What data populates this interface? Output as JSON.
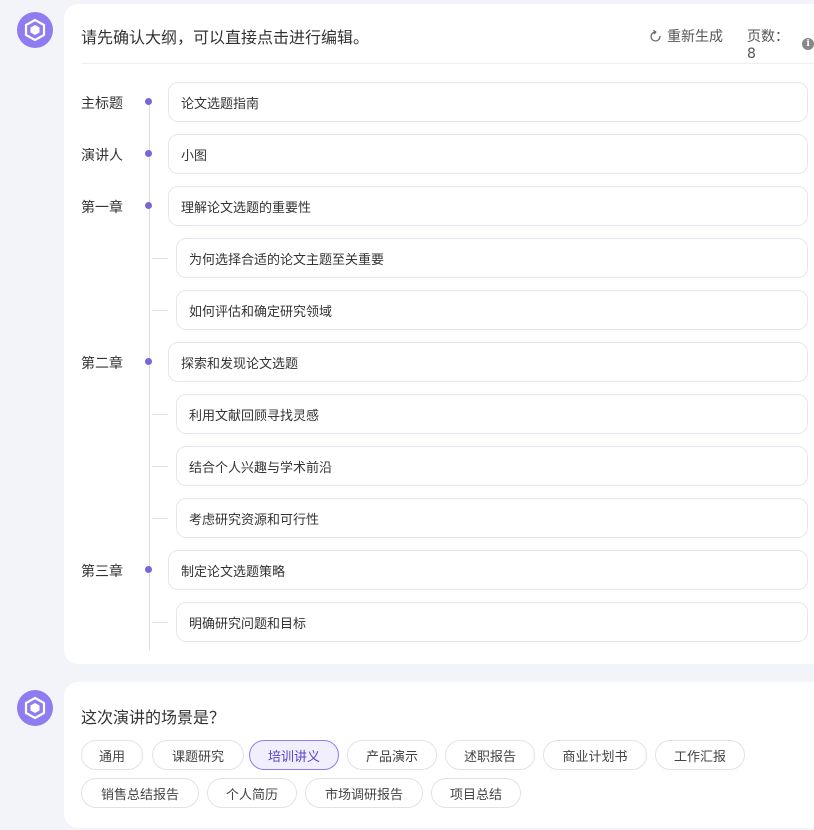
{
  "outline": {
    "prompt": "请先确认大纲，可以直接点击进行编辑。",
    "regenerate_label": "重新生成",
    "pages_label": "页数：8",
    "info_glyph": "i",
    "rows": [
      {
        "label": "主标题",
        "text": "论文选题指南"
      },
      {
        "label": "演讲人",
        "text": "小图"
      },
      {
        "label": "第一章",
        "text": "理解论文选题的重要性"
      },
      {
        "label": "",
        "text": "为何选择合适的论文主题至关重要"
      },
      {
        "label": "",
        "text": "如何评估和确定研究领域"
      },
      {
        "label": "第二章",
        "text": "探索和发现论文选题"
      },
      {
        "label": "",
        "text": "利用文献回顾寻找灵感"
      },
      {
        "label": "",
        "text": "结合个人兴趣与学术前沿"
      },
      {
        "label": "",
        "text": "考虑研究资源和可行性"
      },
      {
        "label": "第三章",
        "text": "制定论文选题策略"
      },
      {
        "label": "",
        "text": "明确研究问题和目标"
      }
    ]
  },
  "scene": {
    "question": "这次演讲的场景是？",
    "selected": "培训讲义",
    "options": [
      "通用",
      "课题研究",
      "培训讲义",
      "产品演示",
      "述职报告",
      "商业计划书",
      "工作汇报",
      "销售总结报告",
      "个人简历",
      "市场调研报告",
      "项目总结"
    ]
  },
  "colors": {
    "accent": "#8e7cf0",
    "dot": "#7b65d6",
    "background": "#f3f4f9"
  },
  "icons": {
    "assistant": "assistant-logo-icon",
    "regenerate": "refresh-icon",
    "info": "info-icon"
  }
}
